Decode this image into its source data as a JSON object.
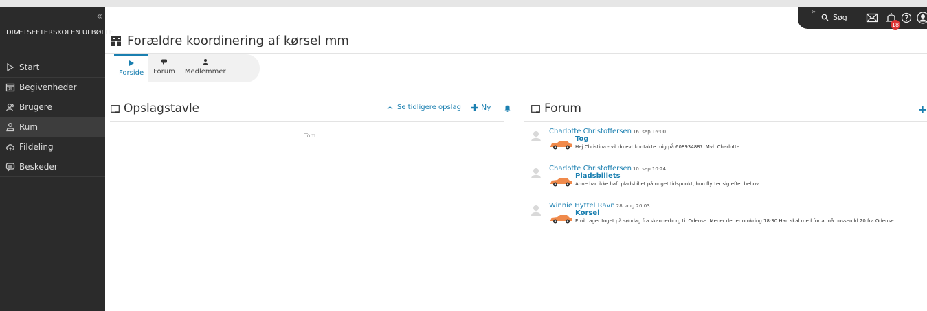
{
  "sidebar": {
    "collapse_glyph": "«",
    "school_name": "IDRÆTSEFTERSKOLEN ULBØLLE",
    "items": [
      {
        "label": "Start",
        "icon": "play-icon"
      },
      {
        "label": "Begivenheder",
        "icon": "calendar-icon"
      },
      {
        "label": "Brugere",
        "icon": "users-icon"
      },
      {
        "label": "Rum",
        "icon": "room-icon"
      },
      {
        "label": "Fildeling",
        "icon": "cloud-icon"
      },
      {
        "label": "Beskeder",
        "icon": "chat-icon"
      }
    ]
  },
  "topbar": {
    "expand_glyph": "»",
    "search_label": "Søg",
    "notification_count": "18"
  },
  "page": {
    "title": "Forældre koordinering af kørsel mm"
  },
  "tabs": [
    {
      "label": "Forside",
      "icon": "play-icon"
    },
    {
      "label": "Forum",
      "icon": "chat-icon"
    },
    {
      "label": "Medlemmer",
      "icon": "person-icon"
    }
  ],
  "opslagstavle": {
    "title": "Opslagstavle",
    "earlier_label": "Se tidligere opslag",
    "new_label": "Ny",
    "empty_text": "Tom"
  },
  "forum": {
    "title": "Forum",
    "add_glyph": "+",
    "posts": [
      {
        "author": "Charlotte Christoffersen",
        "date": "16. sep 16:00",
        "title": "Tog",
        "text": "Hej Christina - vil du evt kontakte mig på 60893488?. Mvh Charlotte"
      },
      {
        "author": "Charlotte Christoffersen",
        "date": "10. sep 10:24",
        "title": "Pladsbillets",
        "text": "Anne har ikke haft pladsbillet på noget tidspunkt, hun flytter sig efter behov."
      },
      {
        "author": "Winnie Hyttel Ravn",
        "date": "28. aug 20:03",
        "title": "Kørsel",
        "text": "Emil tager toget på søndag fra skanderborg til Odense. Mener det er omkring 18:30 Han skal med for at nå bussen kl 20 fra Odense."
      }
    ]
  }
}
